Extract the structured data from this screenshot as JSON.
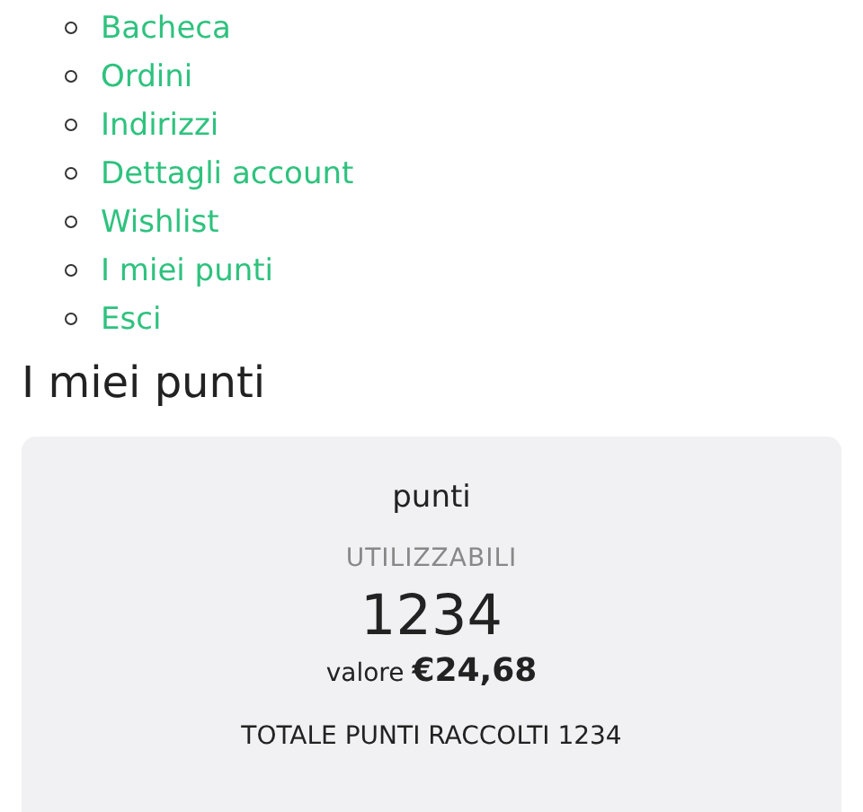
{
  "account_menu": [
    {
      "label": "Bacheca"
    },
    {
      "label": "Ordini"
    },
    {
      "label": "Indirizzi"
    },
    {
      "label": "Dettagli account"
    },
    {
      "label": "Wishlist"
    },
    {
      "label": "I miei punti"
    },
    {
      "label": "Esci"
    }
  ],
  "heading": "I miei punti",
  "points_card": {
    "title": "punti",
    "subtitle": "UTILIZZABILI",
    "points": "1234",
    "value": "valore **€24,68**",
    "total": "TOTALE PUNTI RACCOLTI 1234"
  }
}
